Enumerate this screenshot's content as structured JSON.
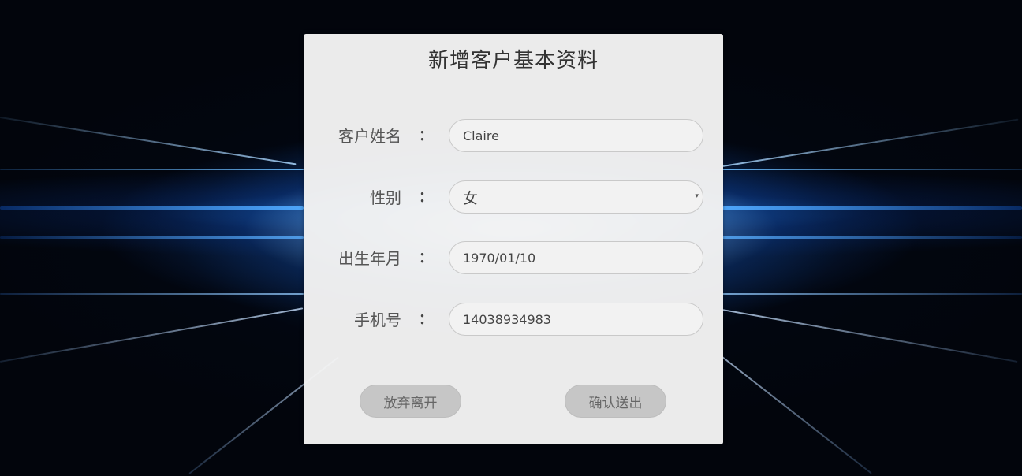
{
  "form": {
    "title": "新增客户基本资料",
    "colon": "：",
    "fields": {
      "name": {
        "label": "客户姓名",
        "value": "Claire"
      },
      "gender": {
        "label": "性别",
        "value": "女",
        "arrow": "▾"
      },
      "birth": {
        "label": "出生年月",
        "value": "1970/01/10"
      },
      "phone": {
        "label": "手机号",
        "value": "14038934983"
      }
    },
    "buttons": {
      "cancel": "放弃离开",
      "submit": "确认送出"
    }
  },
  "colors": {
    "card_bg": "#f3f3f3",
    "button_bg": "#c6c6c6",
    "page_bg": "#02050c",
    "glow": "#2a8cff"
  }
}
